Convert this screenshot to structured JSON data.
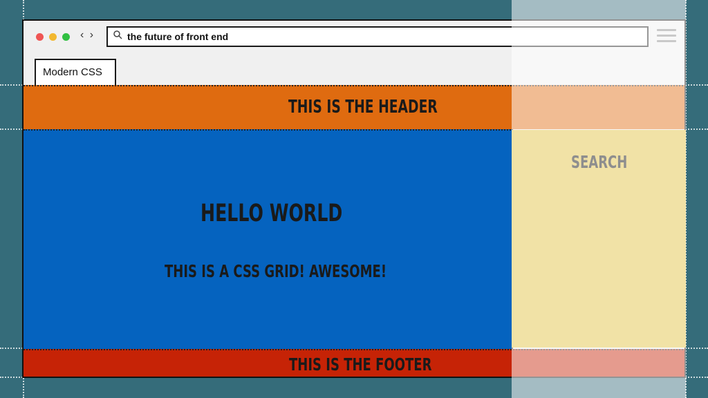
{
  "browser": {
    "window_controls": {
      "close_color": "#ef5554",
      "minimize_color": "#f2b830",
      "maximize_color": "#31c042"
    },
    "nav_arrows": "‹ ›",
    "address_bar": {
      "icon": "search-icon",
      "text": "the future of front end"
    },
    "tab": {
      "label": "Modern CSS"
    }
  },
  "page": {
    "header_text": "THIS IS THE HEADER",
    "main_title": "HELLO WORLD",
    "main_subtitle": "THIS IS A CSS GRID! AWESOME!",
    "footer_text": "THIS IS THE FOOTER",
    "sidebar_text": "SEARCH"
  },
  "colors": {
    "background": "#356c7a",
    "header": "#df6b10",
    "main": "#0563bf",
    "footer": "#c62306",
    "sidebar": "#f1e2a6"
  }
}
